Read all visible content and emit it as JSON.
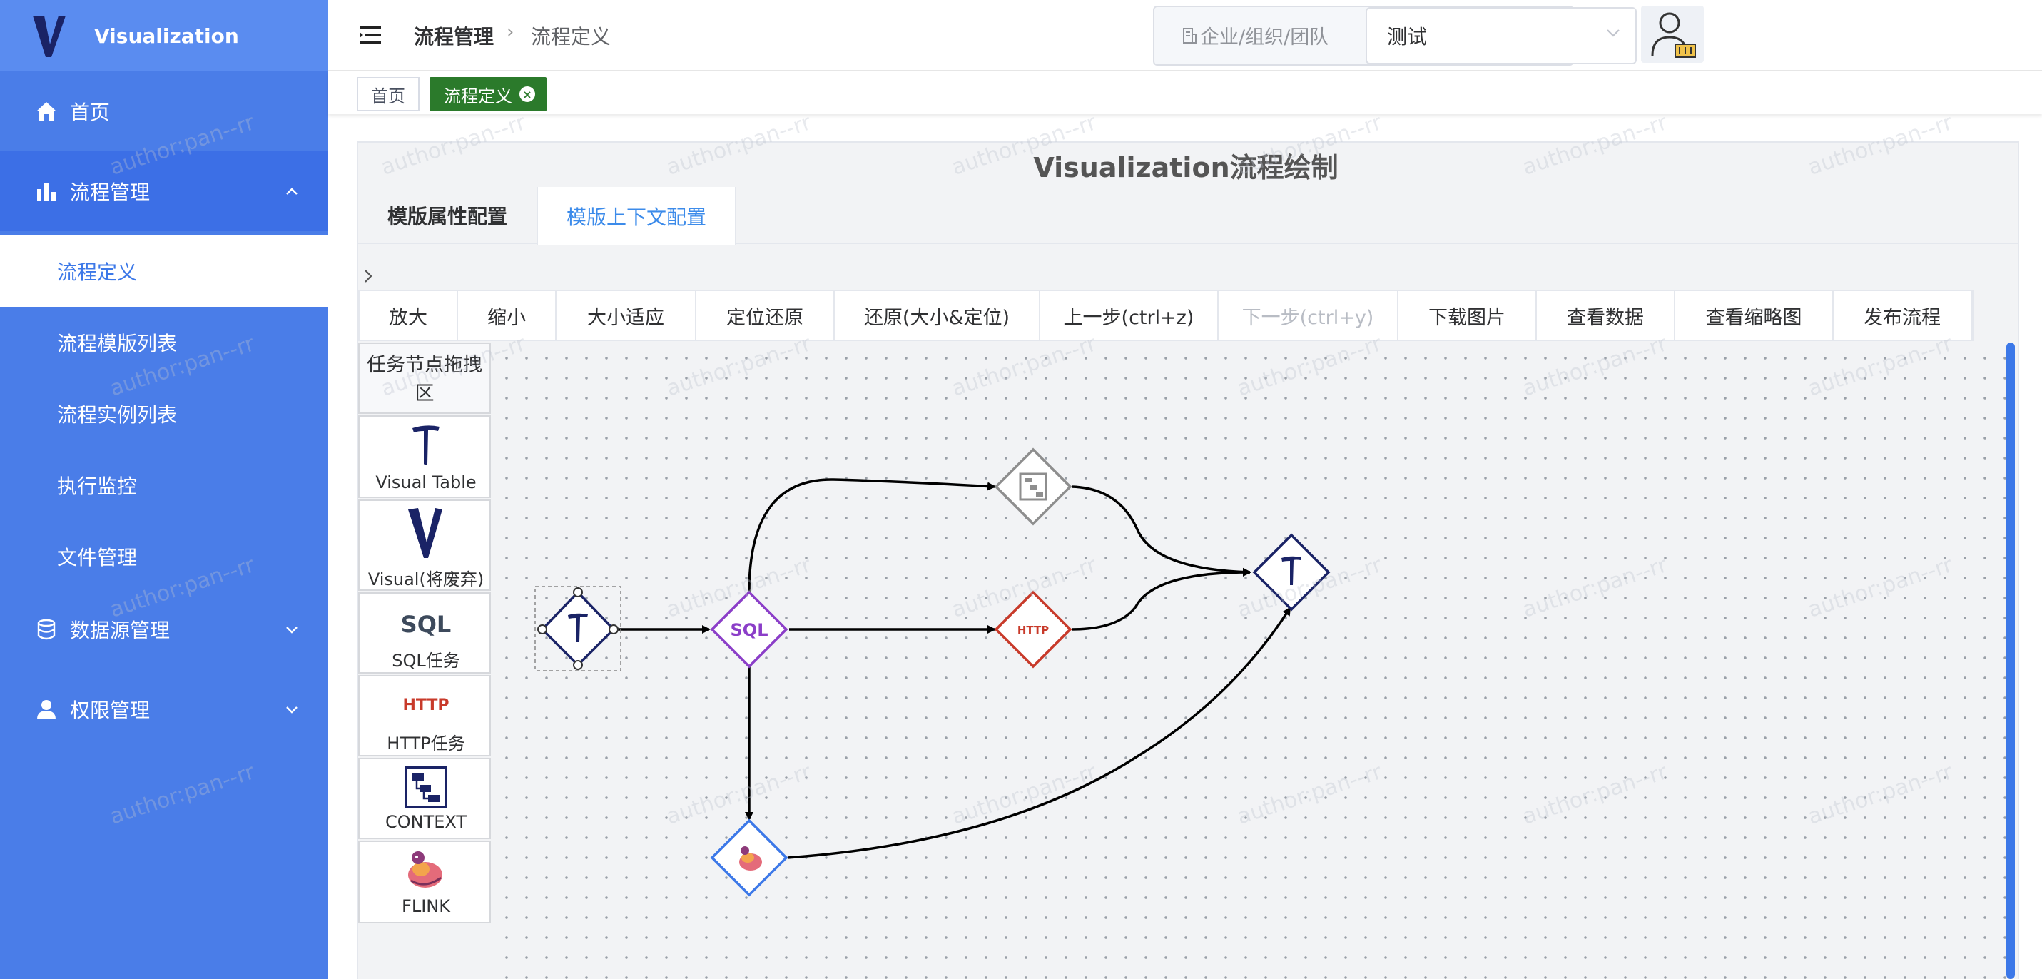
{
  "app": {
    "title": "Visualization",
    "accent": "#4a7de8",
    "watermark": "author:pan--rr"
  },
  "sidebar": {
    "items": [
      {
        "label": "首页",
        "icon": "home-icon"
      },
      {
        "label": "流程管理",
        "icon": "bar-chart-icon",
        "expanded": true
      },
      {
        "label": "数据源管理",
        "icon": "database-icon",
        "expanded": false
      },
      {
        "label": "权限管理",
        "icon": "user-icon",
        "expanded": false
      }
    ],
    "submenu": [
      {
        "label": "流程定义",
        "active": true
      },
      {
        "label": "流程模版列表"
      },
      {
        "label": "流程实例列表"
      },
      {
        "label": "执行监控"
      },
      {
        "label": "文件管理"
      }
    ]
  },
  "header": {
    "breadcrumb": [
      "流程管理",
      "流程定义"
    ],
    "org_label": "企业/组织/团队",
    "org_value": "测试"
  },
  "tags": {
    "home": "首页",
    "active": "流程定义"
  },
  "panel": {
    "title": "Visualization流程绘制",
    "tabs": [
      "模版属性配置",
      "模版上下文配置"
    ],
    "active_tab": 1
  },
  "toolbar": [
    {
      "label": "放大",
      "enabled": true
    },
    {
      "label": "缩小",
      "enabled": true
    },
    {
      "label": "大小适应",
      "enabled": true
    },
    {
      "label": "定位还原",
      "enabled": true
    },
    {
      "label": "还原(大小&定位)",
      "enabled": true
    },
    {
      "label": "上一步(ctrl+z)",
      "enabled": true
    },
    {
      "label": "下一步(ctrl+y)",
      "enabled": false
    },
    {
      "label": "下载图片",
      "enabled": true
    },
    {
      "label": "查看数据",
      "enabled": true
    },
    {
      "label": "查看缩略图",
      "enabled": true
    },
    {
      "label": "发布流程",
      "enabled": true
    }
  ],
  "palette": {
    "title": "任务节点拖拽区",
    "items": [
      {
        "label": "Visual Table",
        "icon": "visual-table-icon"
      },
      {
        "label": "Visual(将废弃)",
        "icon": "visual-v-icon"
      },
      {
        "label": "SQL任务",
        "icon": "sql-icon",
        "glyph": "SQL"
      },
      {
        "label": "HTTP任务",
        "icon": "http-icon",
        "glyph": "HTTP"
      },
      {
        "label": "CONTEXT",
        "icon": "context-icon"
      },
      {
        "label": "FLINK",
        "icon": "flink-icon"
      }
    ]
  },
  "graph": {
    "node_labels": {
      "sql": "SQL",
      "http": "HTTP",
      "table": "T"
    },
    "colors": {
      "table": "#1a2366",
      "sql": "#8b3ec8",
      "http": "#c83a2a",
      "context": "#8e8e8e",
      "flink": "#3c78e8",
      "edge": "#000000"
    }
  }
}
